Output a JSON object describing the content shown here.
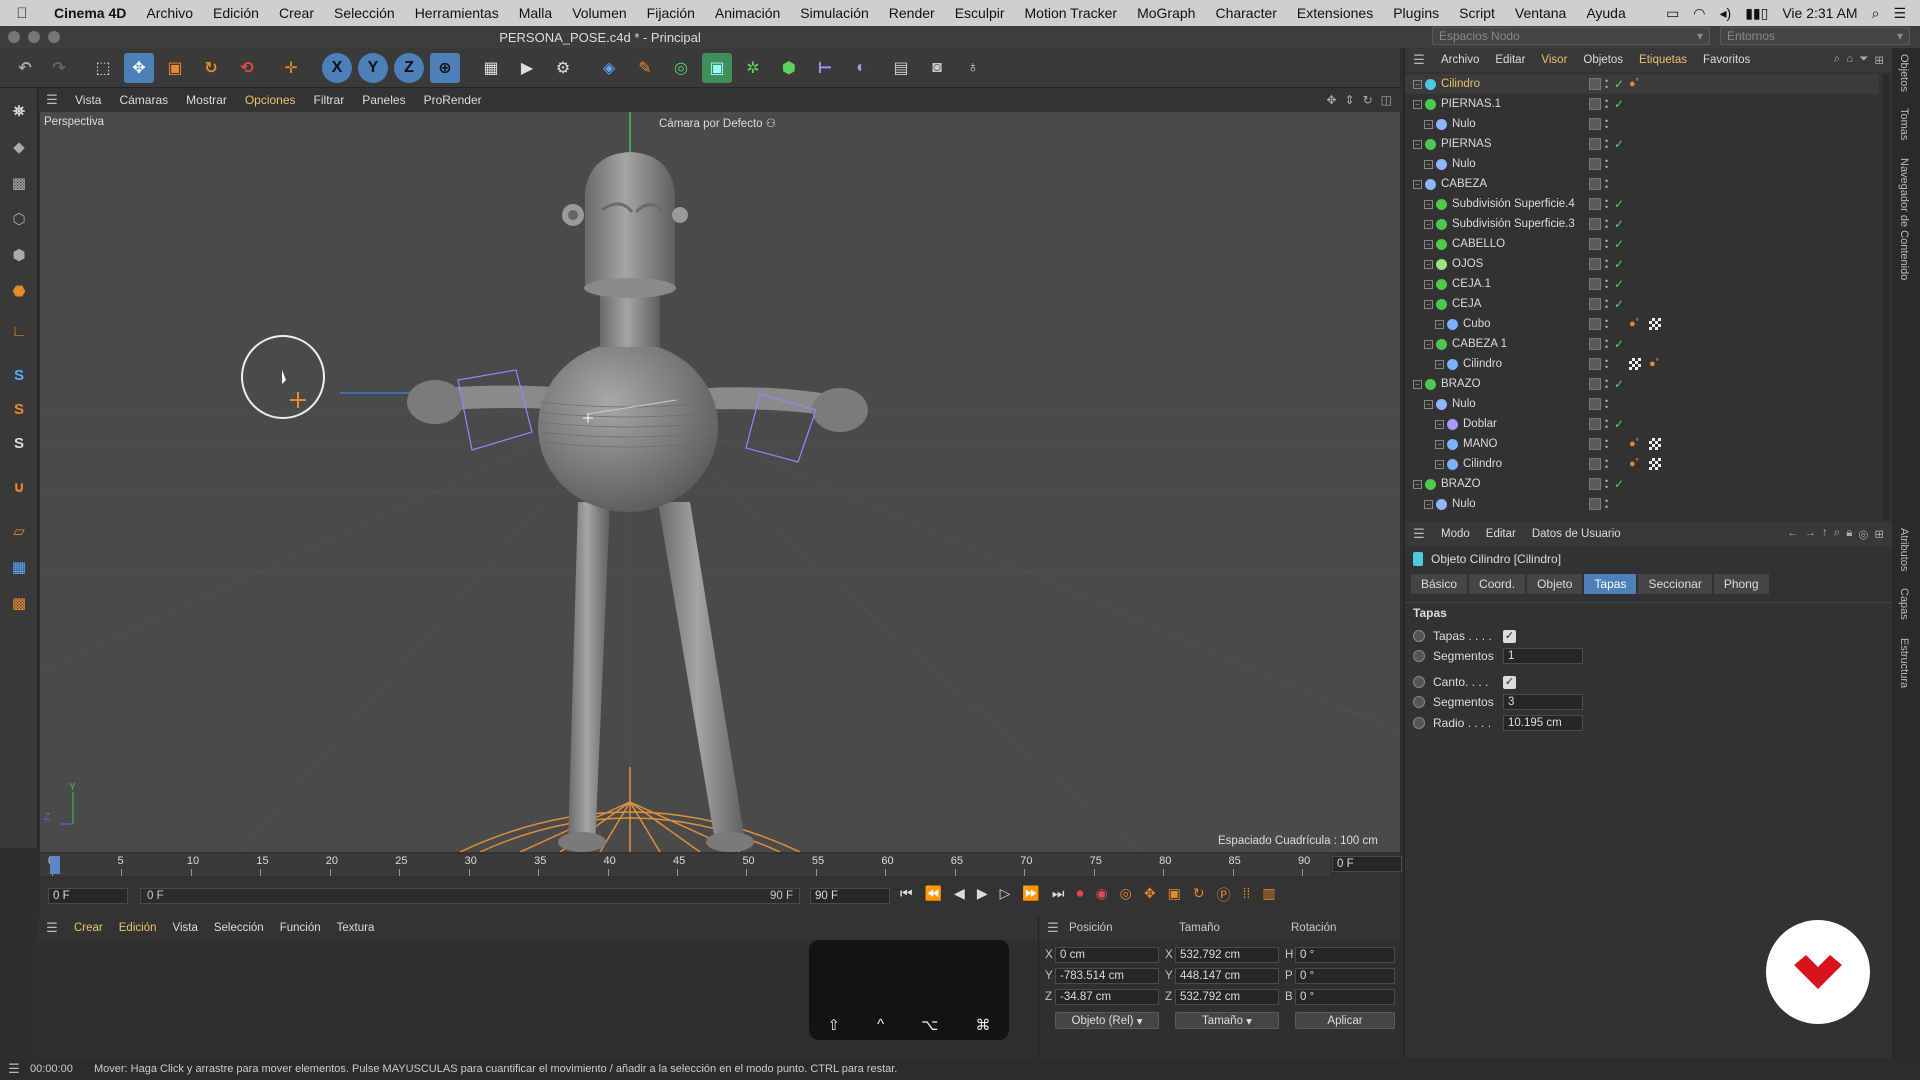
{
  "macbar": {
    "app": "Cinema 4D",
    "menus": [
      "Archivo",
      "Edición",
      "Crear",
      "Selección",
      "Herramientas",
      "Malla",
      "Volumen",
      "Fijación",
      "Animación",
      "Simulación",
      "Render",
      "Esculpir",
      "Motion Tracker",
      "MoGraph",
      "Character",
      "Extensiones",
      "Plugins",
      "Script",
      "Ventana",
      "Ayuda"
    ],
    "clock": "Vie 2:31 AM"
  },
  "window": {
    "title": "PERSONA_POSE.c4d * - Principal",
    "layout_select": "Espacios Nodo",
    "env_select": "Entornos"
  },
  "viewport_menu": {
    "items": [
      "Vista",
      "Cámaras",
      "Mostrar",
      "Opciones",
      "Filtrar",
      "Paneles",
      "ProRender"
    ],
    "active": "Opciones"
  },
  "viewport": {
    "label": "Perspectiva",
    "camera": "Cámara por Defecto",
    "grid_spacing": "Espaciado Cuadrícula : 100 cm",
    "axis_y": "Y",
    "axis_z": "Z"
  },
  "timeline": {
    "ticks": [
      "0",
      "5",
      "10",
      "15",
      "20",
      "25",
      "30",
      "35",
      "40",
      "45",
      "50",
      "55",
      "60",
      "65",
      "70",
      "75",
      "80",
      "85",
      "90"
    ],
    "current_frame_right": "0 F",
    "start_field": "0 F",
    "min_field": "0 F",
    "max_field": "90 F",
    "end_field": "90 F"
  },
  "materials_menu": {
    "items": [
      "Crear",
      "Edición",
      "Vista",
      "Selección",
      "Función",
      "Textura"
    ],
    "active": [
      "Crear",
      "Edición"
    ]
  },
  "coords": {
    "headers": [
      "Posición",
      "Tamaño",
      "Rotación"
    ],
    "rows": [
      {
        "axis": "X",
        "pos": "0 cm",
        "size_axis": "X",
        "size": "532.792 cm",
        "rot_axis": "H",
        "rot": "0 °"
      },
      {
        "axis": "Y",
        "pos": "-783.514 cm",
        "size_axis": "Y",
        "size": "448.147 cm",
        "rot_axis": "P",
        "rot": "0 °"
      },
      {
        "axis": "Z",
        "pos": "-34.87 cm",
        "size_axis": "Z",
        "size": "532.792 cm",
        "rot_axis": "B",
        "rot": "0 °"
      }
    ],
    "mode_select": "Objeto (Rel)",
    "size_select": "Tamaño",
    "apply": "Aplicar"
  },
  "objects_menu": {
    "items": [
      "Archivo",
      "Editar",
      "Visor",
      "Objetos",
      "Etiquetas",
      "Favoritos"
    ],
    "active": [
      "Visor",
      "Etiquetas"
    ]
  },
  "objects": [
    {
      "name": "Cilindro",
      "level": 0,
      "icon": "#4ec9e0",
      "sel": true,
      "check": true,
      "tags": [
        "dots"
      ]
    },
    {
      "name": "PIERNAS.1",
      "level": 0,
      "icon": "#4ec94e",
      "check": true,
      "tags": []
    },
    {
      "name": "Nulo",
      "level": 1,
      "icon": "#8fb4ff",
      "check": false,
      "tags": []
    },
    {
      "name": "PIERNAS",
      "level": 0,
      "icon": "#4ec94e",
      "check": true,
      "tags": []
    },
    {
      "name": "Nulo",
      "level": 1,
      "icon": "#8fb4ff",
      "check": false,
      "tags": []
    },
    {
      "name": "CABEZA",
      "level": 0,
      "icon": "#8fb4ff",
      "check": false,
      "tags": []
    },
    {
      "name": "Subdivisión Superficie.4",
      "level": 1,
      "icon": "#4ec94e",
      "check": true,
      "tags": []
    },
    {
      "name": "Subdivisión Superficie.3",
      "level": 1,
      "icon": "#4ec94e",
      "check": true,
      "tags": []
    },
    {
      "name": "CABELLO",
      "level": 1,
      "icon": "#4ec94e",
      "check": true,
      "tags": []
    },
    {
      "name": "OJOS",
      "level": 1,
      "icon": "#9be37b",
      "check": true,
      "tags": []
    },
    {
      "name": "CEJA.1",
      "level": 1,
      "icon": "#4ec94e",
      "check": true,
      "tags": []
    },
    {
      "name": "CEJA",
      "level": 1,
      "icon": "#4ec94e",
      "check": true,
      "tags": []
    },
    {
      "name": "Cubo",
      "level": 2,
      "icon": "#7ab0ff",
      "check": false,
      "tags": [
        "dots",
        "checker"
      ]
    },
    {
      "name": "CABEZA 1",
      "level": 1,
      "icon": "#4ec94e",
      "check": true,
      "tags": []
    },
    {
      "name": "Cilindro",
      "level": 2,
      "icon": "#7ab0ff",
      "check": false,
      "tags": [
        "checker",
        "dots"
      ]
    },
    {
      "name": "BRAZO",
      "level": 0,
      "icon": "#4ec94e",
      "check": true,
      "tags": []
    },
    {
      "name": "Nulo",
      "level": 1,
      "icon": "#8fb4ff",
      "check": false,
      "tags": []
    },
    {
      "name": "Doblar",
      "level": 2,
      "icon": "#a39cff",
      "check": true,
      "tags": []
    },
    {
      "name": "MANO",
      "level": 2,
      "icon": "#7ab0ff",
      "check": false,
      "tags": [
        "dots",
        "checker"
      ]
    },
    {
      "name": "Cilindro",
      "level": 2,
      "icon": "#7ab0ff",
      "check": false,
      "tags": [
        "dots",
        "checker"
      ]
    },
    {
      "name": "BRAZO",
      "level": 0,
      "icon": "#4ec94e",
      "check": true,
      "tags": []
    },
    {
      "name": "Nulo",
      "level": 1,
      "icon": "#8fb4ff",
      "check": false,
      "tags": []
    }
  ],
  "attributes": {
    "menu": [
      "Modo",
      "Editar",
      "Datos de Usuario"
    ],
    "object_title": "Objeto Cilindro [Cilindro]",
    "tabs": [
      "Básico",
      "Coord.",
      "Objeto",
      "Tapas",
      "Seccionar",
      "Phong"
    ],
    "active_tab": "Tapas",
    "section": "Tapas",
    "fields": [
      {
        "label": "Tapas . . . .",
        "type": "check",
        "value": "✓"
      },
      {
        "label": "Segmentos",
        "type": "num",
        "value": "1"
      },
      {
        "label": "Canto. . . .",
        "type": "check",
        "value": "✓"
      },
      {
        "label": "Segmentos",
        "type": "num",
        "value": "3"
      },
      {
        "label": "Radio . . . .",
        "type": "num",
        "value": "10.195 cm"
      }
    ]
  },
  "right_strip": [
    "Objetos",
    "Tomas",
    "Navegador de Contenido",
    "Atributos",
    "Capas",
    "Estructura"
  ],
  "status": {
    "time": "00:00:00",
    "message": "Mover: Haga Click y arrastre para mover elementos. Pulse MAYUSCULAS para cuantificar el movimiento / añadir a la selección en el modo punto. CTRL para restar."
  },
  "keys_overlay": [
    "⇧",
    "^",
    "⌥",
    "⌘"
  ],
  "colors": {
    "accent": "#4d7fba",
    "active_menu": "#e8c470",
    "check": "#5ed25e",
    "logo": "#d8141b"
  }
}
